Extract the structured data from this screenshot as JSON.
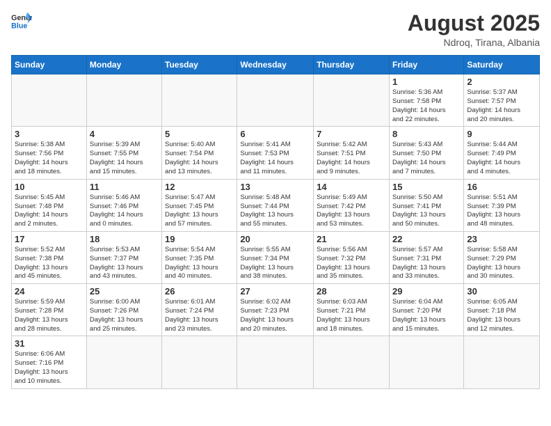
{
  "header": {
    "logo_general": "General",
    "logo_blue": "Blue",
    "month_year": "August 2025",
    "location": "Ndroq, Tirana, Albania"
  },
  "weekdays": [
    "Sunday",
    "Monday",
    "Tuesday",
    "Wednesday",
    "Thursday",
    "Friday",
    "Saturday"
  ],
  "weeks": [
    [
      {
        "day": "",
        "info": ""
      },
      {
        "day": "",
        "info": ""
      },
      {
        "day": "",
        "info": ""
      },
      {
        "day": "",
        "info": ""
      },
      {
        "day": "",
        "info": ""
      },
      {
        "day": "1",
        "info": "Sunrise: 5:36 AM\nSunset: 7:58 PM\nDaylight: 14 hours\nand 22 minutes."
      },
      {
        "day": "2",
        "info": "Sunrise: 5:37 AM\nSunset: 7:57 PM\nDaylight: 14 hours\nand 20 minutes."
      }
    ],
    [
      {
        "day": "3",
        "info": "Sunrise: 5:38 AM\nSunset: 7:56 PM\nDaylight: 14 hours\nand 18 minutes."
      },
      {
        "day": "4",
        "info": "Sunrise: 5:39 AM\nSunset: 7:55 PM\nDaylight: 14 hours\nand 15 minutes."
      },
      {
        "day": "5",
        "info": "Sunrise: 5:40 AM\nSunset: 7:54 PM\nDaylight: 14 hours\nand 13 minutes."
      },
      {
        "day": "6",
        "info": "Sunrise: 5:41 AM\nSunset: 7:53 PM\nDaylight: 14 hours\nand 11 minutes."
      },
      {
        "day": "7",
        "info": "Sunrise: 5:42 AM\nSunset: 7:51 PM\nDaylight: 14 hours\nand 9 minutes."
      },
      {
        "day": "8",
        "info": "Sunrise: 5:43 AM\nSunset: 7:50 PM\nDaylight: 14 hours\nand 7 minutes."
      },
      {
        "day": "9",
        "info": "Sunrise: 5:44 AM\nSunset: 7:49 PM\nDaylight: 14 hours\nand 4 minutes."
      }
    ],
    [
      {
        "day": "10",
        "info": "Sunrise: 5:45 AM\nSunset: 7:48 PM\nDaylight: 14 hours\nand 2 minutes."
      },
      {
        "day": "11",
        "info": "Sunrise: 5:46 AM\nSunset: 7:46 PM\nDaylight: 14 hours\nand 0 minutes."
      },
      {
        "day": "12",
        "info": "Sunrise: 5:47 AM\nSunset: 7:45 PM\nDaylight: 13 hours\nand 57 minutes."
      },
      {
        "day": "13",
        "info": "Sunrise: 5:48 AM\nSunset: 7:44 PM\nDaylight: 13 hours\nand 55 minutes."
      },
      {
        "day": "14",
        "info": "Sunrise: 5:49 AM\nSunset: 7:42 PM\nDaylight: 13 hours\nand 53 minutes."
      },
      {
        "day": "15",
        "info": "Sunrise: 5:50 AM\nSunset: 7:41 PM\nDaylight: 13 hours\nand 50 minutes."
      },
      {
        "day": "16",
        "info": "Sunrise: 5:51 AM\nSunset: 7:39 PM\nDaylight: 13 hours\nand 48 minutes."
      }
    ],
    [
      {
        "day": "17",
        "info": "Sunrise: 5:52 AM\nSunset: 7:38 PM\nDaylight: 13 hours\nand 45 minutes."
      },
      {
        "day": "18",
        "info": "Sunrise: 5:53 AM\nSunset: 7:37 PM\nDaylight: 13 hours\nand 43 minutes."
      },
      {
        "day": "19",
        "info": "Sunrise: 5:54 AM\nSunset: 7:35 PM\nDaylight: 13 hours\nand 40 minutes."
      },
      {
        "day": "20",
        "info": "Sunrise: 5:55 AM\nSunset: 7:34 PM\nDaylight: 13 hours\nand 38 minutes."
      },
      {
        "day": "21",
        "info": "Sunrise: 5:56 AM\nSunset: 7:32 PM\nDaylight: 13 hours\nand 35 minutes."
      },
      {
        "day": "22",
        "info": "Sunrise: 5:57 AM\nSunset: 7:31 PM\nDaylight: 13 hours\nand 33 minutes."
      },
      {
        "day": "23",
        "info": "Sunrise: 5:58 AM\nSunset: 7:29 PM\nDaylight: 13 hours\nand 30 minutes."
      }
    ],
    [
      {
        "day": "24",
        "info": "Sunrise: 5:59 AM\nSunset: 7:28 PM\nDaylight: 13 hours\nand 28 minutes."
      },
      {
        "day": "25",
        "info": "Sunrise: 6:00 AM\nSunset: 7:26 PM\nDaylight: 13 hours\nand 25 minutes."
      },
      {
        "day": "26",
        "info": "Sunrise: 6:01 AM\nSunset: 7:24 PM\nDaylight: 13 hours\nand 23 minutes."
      },
      {
        "day": "27",
        "info": "Sunrise: 6:02 AM\nSunset: 7:23 PM\nDaylight: 13 hours\nand 20 minutes."
      },
      {
        "day": "28",
        "info": "Sunrise: 6:03 AM\nSunset: 7:21 PM\nDaylight: 13 hours\nand 18 minutes."
      },
      {
        "day": "29",
        "info": "Sunrise: 6:04 AM\nSunset: 7:20 PM\nDaylight: 13 hours\nand 15 minutes."
      },
      {
        "day": "30",
        "info": "Sunrise: 6:05 AM\nSunset: 7:18 PM\nDaylight: 13 hours\nand 12 minutes."
      }
    ],
    [
      {
        "day": "31",
        "info": "Sunrise: 6:06 AM\nSunset: 7:16 PM\nDaylight: 13 hours\nand 10 minutes."
      },
      {
        "day": "",
        "info": ""
      },
      {
        "day": "",
        "info": ""
      },
      {
        "day": "",
        "info": ""
      },
      {
        "day": "",
        "info": ""
      },
      {
        "day": "",
        "info": ""
      },
      {
        "day": "",
        "info": ""
      }
    ]
  ]
}
